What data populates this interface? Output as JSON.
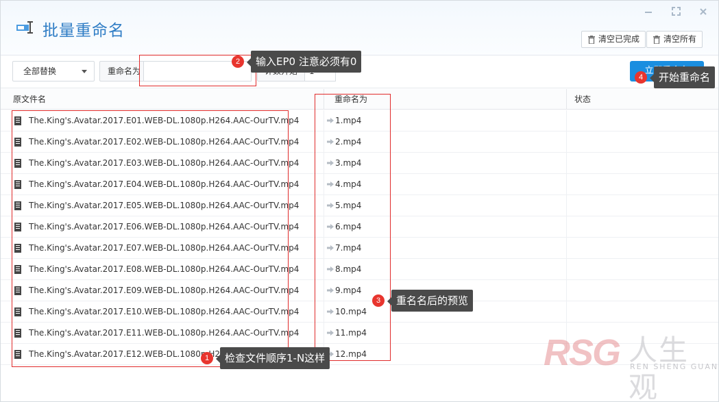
{
  "window": {
    "title": "批量重命名",
    "controls": [
      "minimize-icon",
      "maximize-icon",
      "close-icon"
    ],
    "clear_done_label": "清空已完成",
    "clear_all_label": "清空所有"
  },
  "toolbar": {
    "mode_selected": "全部替换",
    "rename_label": "重命名为",
    "rename_value": "",
    "count_label": "计数开始",
    "count_value": "1",
    "start_label": "立即重命名",
    "accent": "#1a8ee0"
  },
  "table": {
    "headers": [
      "原文件名",
      "重命名为",
      "状态"
    ],
    "rows": [
      {
        "original": "The.King's.Avatar.2017.E01.WEB-DL.1080p.H264.AAC-OurTV.mp4",
        "renamed": "1.mp4",
        "status": ""
      },
      {
        "original": "The.King's.Avatar.2017.E02.WEB-DL.1080p.H264.AAC-OurTV.mp4",
        "renamed": "2.mp4",
        "status": ""
      },
      {
        "original": "The.King's.Avatar.2017.E03.WEB-DL.1080p.H264.AAC-OurTV.mp4",
        "renamed": "3.mp4",
        "status": ""
      },
      {
        "original": "The.King's.Avatar.2017.E04.WEB-DL.1080p.H264.AAC-OurTV.mp4",
        "renamed": "4.mp4",
        "status": ""
      },
      {
        "original": "The.King's.Avatar.2017.E05.WEB-DL.1080p.H264.AAC-OurTV.mp4",
        "renamed": "5.mp4",
        "status": ""
      },
      {
        "original": "The.King's.Avatar.2017.E06.WEB-DL.1080p.H264.AAC-OurTV.mp4",
        "renamed": "6.mp4",
        "status": ""
      },
      {
        "original": "The.King's.Avatar.2017.E07.WEB-DL.1080p.H264.AAC-OurTV.mp4",
        "renamed": "7.mp4",
        "status": ""
      },
      {
        "original": "The.King's.Avatar.2017.E08.WEB-DL.1080p.H264.AAC-OurTV.mp4",
        "renamed": "8.mp4",
        "status": ""
      },
      {
        "original": "The.King's.Avatar.2017.E09.WEB-DL.1080p.H264.AAC-OurTV.mp4",
        "renamed": "9.mp4",
        "status": ""
      },
      {
        "original": "The.King's.Avatar.2017.E10.WEB-DL.1080p.H264.AAC-OurTV.mp4",
        "renamed": "10.mp4",
        "status": ""
      },
      {
        "original": "The.King's.Avatar.2017.E11.WEB-DL.1080p.H264.AAC-OurTV.mp4",
        "renamed": "11.mp4",
        "status": ""
      },
      {
        "original": "The.King's.Avatar.2017.E12.WEB-DL.1080p.H264.AAC-OurTV.mp4",
        "renamed": "12.mp4",
        "status": ""
      }
    ]
  },
  "annotations": [
    {
      "number": "1",
      "text": "检查文件顺序1-N这样"
    },
    {
      "number": "2",
      "text": "输入EP0 注意必须有0"
    },
    {
      "number": "3",
      "text": "重名名后的预览"
    },
    {
      "number": "4",
      "text": "开始重命名"
    }
  ],
  "watermark": {
    "brand": "RSG",
    "cn": "人生观",
    "en": "REN SHENG GUAN"
  }
}
